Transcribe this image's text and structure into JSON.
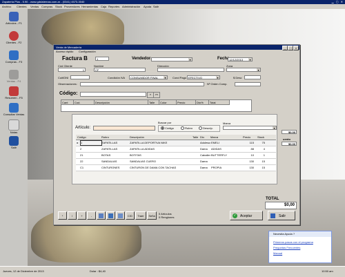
{
  "app": {
    "title": "Zapatería Plus - 5.90 - www.gdsistemas.com.ar - (0341) 4573-3040",
    "menu": [
      "Archivo",
      "Clientes",
      "Ventas",
      "Compras",
      "Stock",
      "Proveedores",
      "Herramientas",
      "Caja",
      "Reportes",
      "Administración",
      "Ayuda",
      "Salir"
    ]
  },
  "sidebar": [
    {
      "label": "Artículos - F1",
      "icon": "articles-icon"
    },
    {
      "label": "Clientes - F2",
      "icon": "clients-icon"
    },
    {
      "label": "Compras - F3",
      "icon": "purchases-icon"
    },
    {
      "label": "Ventas - F4",
      "icon": "sales-icon"
    },
    {
      "label": "Resumen - F5",
      "icon": "summary-icon"
    },
    {
      "label": "Consultar Ventas",
      "icon": "query-sales-icon"
    },
    {
      "label": "Notas",
      "icon": "notes-icon"
    },
    {
      "label": "Salir",
      "icon": "exit-icon"
    }
  ],
  "window": {
    "title": "Venta de Mercadería",
    "menu": [
      "Acceso rápido",
      "Configuración"
    ],
    "factura_label": "Factura B",
    "factura_number": "1",
    "vendedor_label": "Vendedor",
    "fecha_label": "Fecha",
    "fecha_value": "12/12/2013",
    "labels": {
      "cod_cliente": "Cód Cliente",
      "nombre": "Nombre",
      "direccion": "Dirección",
      "zona": "Zona",
      "cuit": "Cuit/DNI",
      "condicion_iva": "Condición IVA",
      "cond_pago": "Cond Pago",
      "desc": "$ Desc",
      "observaciones": "Observaciones:",
      "nro_orden": "Nº Orden Comp."
    },
    "values": {
      "cod_cliente": "1",
      "nombre": "CF",
      "condicion_iva": "CONSUMIDOR FINAL",
      "cond_pago": "EFECTIVO"
    },
    "codigo_label": "Código:",
    "grid_headers": [
      "Cant",
      "Cod.",
      "Descripción",
      "Talle",
      "Color",
      "Precio",
      "Dto%",
      "Total"
    ],
    "right_total": "$0,00",
    "right_total2": "$0,00",
    "right_label": "uento",
    "total_label": "TOTAL",
    "total_value": "$0,00",
    "buttons": [
      "*",
      "/",
      "+",
      "-",
      "",
      "",
      "",
      "C/D",
      "Traer",
      "Seña"
    ],
    "articulos_count": "0 Artículos",
    "renglones_count": "0 Renglones",
    "aceptar": "Aceptar",
    "salir": "Salir"
  },
  "search": {
    "articulo_label": "Artículo:",
    "buscar_por_label": "Buscar por",
    "options": [
      "Código",
      "Rubro",
      "Descrip."
    ],
    "selected_option": 0,
    "marca_label": "Marca",
    "headers": [
      "Código",
      "Rubro",
      "Descripción",
      "Talle",
      "Div.",
      "Marca",
      "Precio",
      "Stock"
    ],
    "rows": [
      {
        "codigo": "1",
        "rubro": "ZAPATILLAS",
        "descripcion": "ZAPATILLA DEPORTIVA NIKE",
        "talle": "",
        "div": "Adolescente",
        "marca": "EMELI",
        "precio": "115",
        "stock": "75"
      },
      {
        "codigo": "2",
        "rubro": "ZAPATILLAS",
        "descripcion": "ZAPATILLA ADIDAS",
        "talle": "",
        "div": "Dama",
        "marca": "ADIDAS",
        "precio": "88",
        "stock": "4"
      },
      {
        "codigo": "21",
        "rubro": "BOTAS",
        "descripcion": "BOTITAS",
        "talle": "",
        "div": "Caballero",
        "marca": "BUTTERFLY",
        "precio": "10",
        "stock": "1"
      },
      {
        "codigo": "22",
        "rubro": "SANDALIAS",
        "descripcion": "SANDALIAS CUERO",
        "talle": "",
        "div": "Dama",
        "marca": "",
        "precio": "130",
        "stock": "15"
      },
      {
        "codigo": "C1",
        "rubro": "CINTURONES",
        "descripcion": "CINTURON DE DAMA CON TACHAS",
        "talle": "",
        "div": "Dama",
        "marca": "PROPIA",
        "precio": "130",
        "stock": "15"
      }
    ]
  },
  "help": {
    "title": "Necesita Ayuda ?",
    "links": [
      "Primeros pasos con el programa",
      "Preguntas Frecuentes",
      "Manual"
    ]
  },
  "statusbar": {
    "date": "Jueves, 12 de Diciembre de 2013",
    "dolar": "Dolar : $4,40",
    "time": "10:50 am"
  }
}
